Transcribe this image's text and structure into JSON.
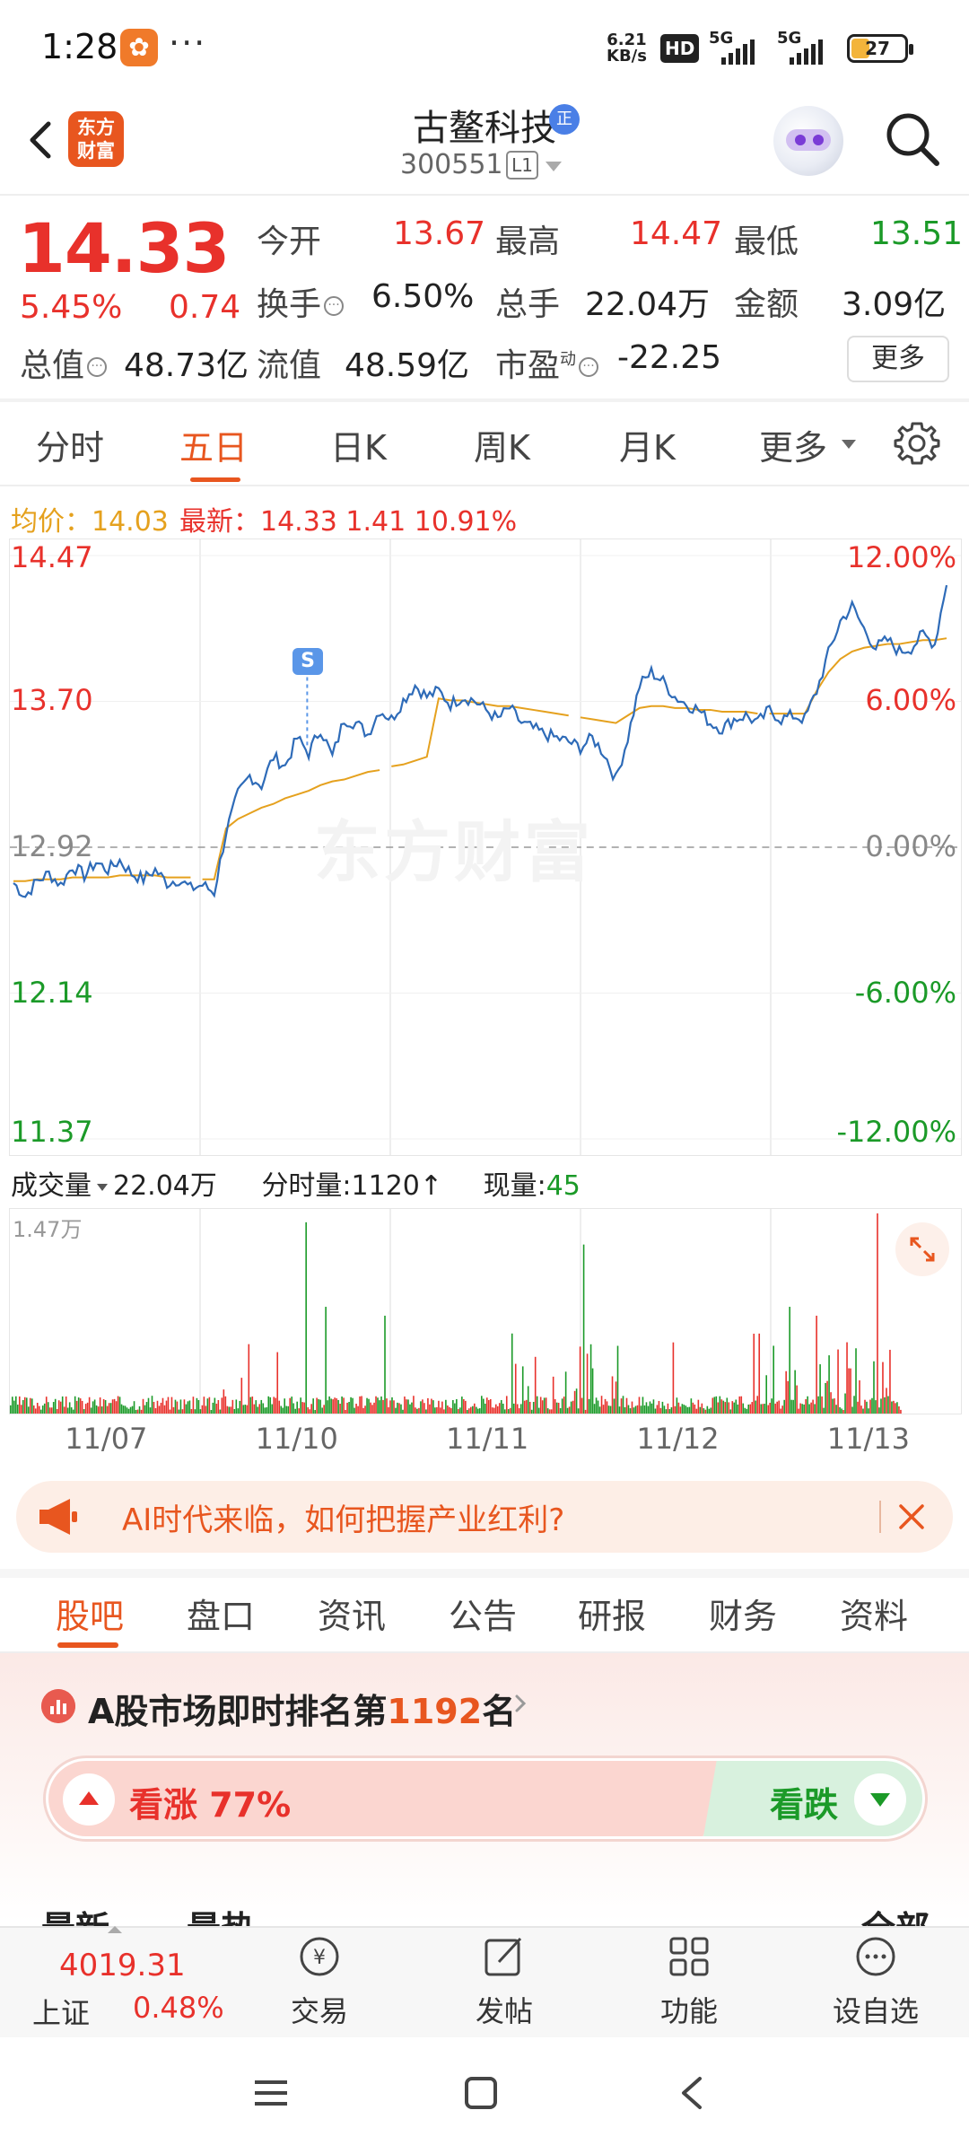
{
  "status": {
    "time": "1:28",
    "app_icon_glyph": "✿",
    "dots": "···",
    "net_speed_1": "6.21",
    "net_speed_2": "KB/s",
    "hd": "HD",
    "sim1": "5G",
    "sim2": "5G",
    "battery": "27"
  },
  "header": {
    "name": "古鳌科技",
    "verified": "正",
    "code": "300551",
    "level": "L1",
    "logo_line1": "东方",
    "logo_line2": "财富"
  },
  "quote": {
    "price": "14.33",
    "pct": "5.45%",
    "change": "0.74",
    "open_lbl": "今开",
    "open": "13.67",
    "high_lbl": "最高",
    "high": "14.47",
    "low_lbl": "最低",
    "low": "13.51",
    "turnover_lbl": "换手",
    "turnover": "6.50%",
    "volume_lbl": "总手",
    "volume": "22.04万",
    "amount_lbl": "金额",
    "amount": "3.09亿",
    "mcap_lbl": "总值",
    "mcap": "48.73亿",
    "float_lbl": "流值",
    "float": "48.59亿",
    "pe_lbl": "市盈",
    "pe_sup": "动",
    "pe": "-22.25",
    "more": "更多"
  },
  "tabs": [
    "分时",
    "五日",
    "日K",
    "周K",
    "月K",
    "更多"
  ],
  "legend": {
    "avg": "均价：14.03",
    "latest": "最新：14.33   1.41   10.91%"
  },
  "chart_data": {
    "type": "line",
    "y_left_ticks": [
      "14.47",
      "13.70",
      "12.92",
      "12.14",
      "11.37"
    ],
    "y_right_ticks": [
      "12.00%",
      "6.00%",
      "0.00%",
      "-6.00%",
      "-12.00%"
    ],
    "ylim": [
      11.37,
      14.47
    ],
    "baseline": 12.92,
    "x_labels": [
      "11/07",
      "11/10",
      "11/11",
      "11/12",
      "11/13"
    ],
    "marker": "S",
    "watermark": "东方财富",
    "series": [
      {
        "values": [
          12.73,
          12.66,
          12.74,
          12.78,
          12.72,
          12.82,
          12.77,
          12.84,
          12.8,
          12.85,
          12.78,
          12.75,
          12.8,
          12.73,
          12.75,
          12.7,
          12.72,
          12.68,
          13.0,
          13.2,
          13.3,
          13.25,
          13.4,
          13.35,
          13.5,
          13.42,
          13.55,
          13.4,
          13.6,
          13.58,
          13.52,
          13.65,
          13.6,
          13.7,
          13.78,
          13.72,
          13.75,
          13.68,
          13.72,
          13.7,
          13.65,
          13.6,
          13.66,
          13.58,
          13.55,
          13.52,
          13.5,
          13.48,
          13.45,
          13.5,
          13.42,
          13.28,
          13.5,
          13.78,
          13.85,
          13.8,
          13.72,
          13.68,
          13.65,
          13.58,
          13.55,
          13.6,
          13.62,
          13.58,
          13.65,
          13.6,
          13.62,
          13.6,
          13.75,
          13.95,
          14.12,
          14.2,
          14.08,
          13.98,
          14.02,
          13.96,
          13.98,
          14.05,
          14.0,
          14.33
        ]
      },
      {
        "values": [
          12.74,
          12.74,
          12.75,
          12.75,
          12.75,
          12.76,
          12.76,
          12.76,
          12.76,
          12.77,
          12.77,
          12.77,
          12.77,
          12.76,
          12.76,
          12.76,
          12.75,
          12.75,
          13.02,
          13.07,
          13.1,
          13.13,
          13.15,
          13.18,
          13.2,
          13.22,
          13.25,
          13.27,
          13.28,
          13.3,
          13.32,
          13.33,
          13.35,
          13.36,
          13.38,
          13.4,
          13.71,
          13.7,
          13.7,
          13.69,
          13.68,
          13.67,
          13.67,
          13.66,
          13.65,
          13.64,
          13.63,
          13.62,
          13.61,
          13.6,
          13.59,
          13.58,
          13.62,
          13.66,
          13.67,
          13.67,
          13.66,
          13.66,
          13.65,
          13.65,
          13.64,
          13.64,
          13.64,
          13.63,
          13.63,
          13.63,
          13.63,
          13.63,
          13.75,
          13.85,
          13.92,
          13.96,
          13.98,
          13.99,
          14.0,
          14.0,
          14.01,
          14.02,
          14.02,
          14.03
        ]
      }
    ]
  },
  "volume": {
    "label": "成交量",
    "total": "22.04万",
    "minute": "分时量:1120↑",
    "current_lbl": "现量:",
    "current": "45",
    "max": "1.47万"
  },
  "banner": {
    "text": "AI时代来临，如何把握产业红利?"
  },
  "section_tabs": [
    "股吧",
    "盘口",
    "资讯",
    "公告",
    "研报",
    "财务",
    "资料"
  ],
  "rank": {
    "prefix": "A股市场即时排名第",
    "num": "1192",
    "suffix": "名"
  },
  "vote": {
    "up": "看涨 77%",
    "up_share": 0.77,
    "down": "看跌"
  },
  "peek": {
    "left1": "最新",
    "left2": "最热",
    "right": "全部"
  },
  "bottom_nav": {
    "index_value": "4019.31",
    "index_name": "上证",
    "index_pct": "0.48%",
    "items": [
      "交易",
      "发帖",
      "功能",
      "设自选"
    ]
  },
  "colors": {
    "up": "#e8312b",
    "down": "#1b9a28",
    "accent": "#e8561f",
    "avg_line": "#e5a11e",
    "price_line": "#2e6bb8"
  }
}
